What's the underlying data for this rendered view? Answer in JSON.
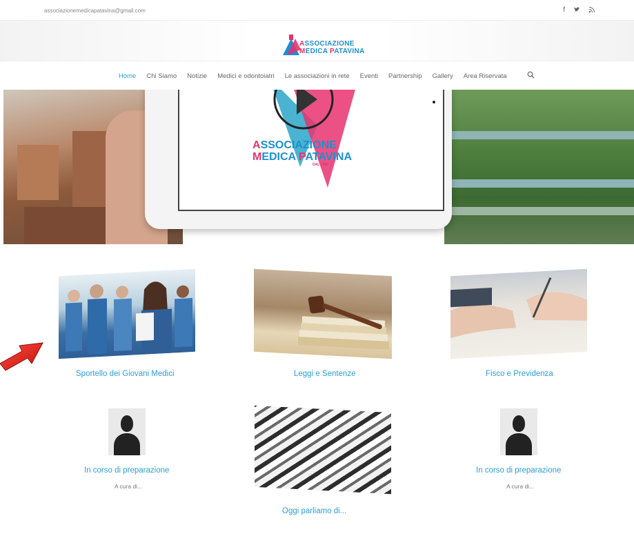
{
  "topbar": {
    "email": "associazionemedicapatavina@gmail.com",
    "social": [
      {
        "name": "facebook-icon",
        "glyph": "f"
      },
      {
        "name": "twitter-icon",
        "glyph": "𝕪"
      },
      {
        "name": "rss-icon",
        "glyph": "\\"
      }
    ]
  },
  "logo": {
    "line1_a": "A",
    "line1_b": "SSOCIAZIONE",
    "line2_a": "M",
    "line2_b": "EDICA ",
    "line2_c": "P",
    "line2_d": "ATAVINA"
  },
  "nav": {
    "items": [
      {
        "label": "Home",
        "active": true
      },
      {
        "label": "Chi Siamo",
        "active": false
      },
      {
        "label": "Notizie",
        "active": false
      },
      {
        "label": "Medici e odontoiatri",
        "active": false
      },
      {
        "label": "Le associazioni in rete",
        "active": false
      },
      {
        "label": "Eventi",
        "active": false
      },
      {
        "label": "Partnership",
        "active": false
      },
      {
        "label": "Gallery",
        "active": false
      },
      {
        "label": "Area Riservata",
        "active": false
      }
    ],
    "search_icon": "search-icon"
  },
  "hero": {
    "logo_line1_a": "A",
    "logo_line1_b": "SSOCIAZIONE",
    "logo_line2_a": "M",
    "logo_line2_b": "EDICA ",
    "logo_line2_c": "P",
    "logo_line2_d": "ATAVINA",
    "since": "DAL 1985"
  },
  "cards": {
    "giovani": {
      "title": "Sportello dei Giovani Medici"
    },
    "leggi": {
      "title": "Leggi e Sentenze"
    },
    "fisco": {
      "title": "Fisco e Previdenza"
    },
    "prep_left": {
      "title": "In corso di preparazione",
      "sub": "A cura di..."
    },
    "oggi": {
      "title": "Oggi parliamo di..."
    },
    "prep_right": {
      "title": "In corso di preparazione",
      "sub": "A cura di..."
    }
  },
  "colors": {
    "accent": "#2b9fd6",
    "brand_blue": "#1b8fd1",
    "brand_pink": "#e8326e",
    "arrow": "#e0201b"
  }
}
